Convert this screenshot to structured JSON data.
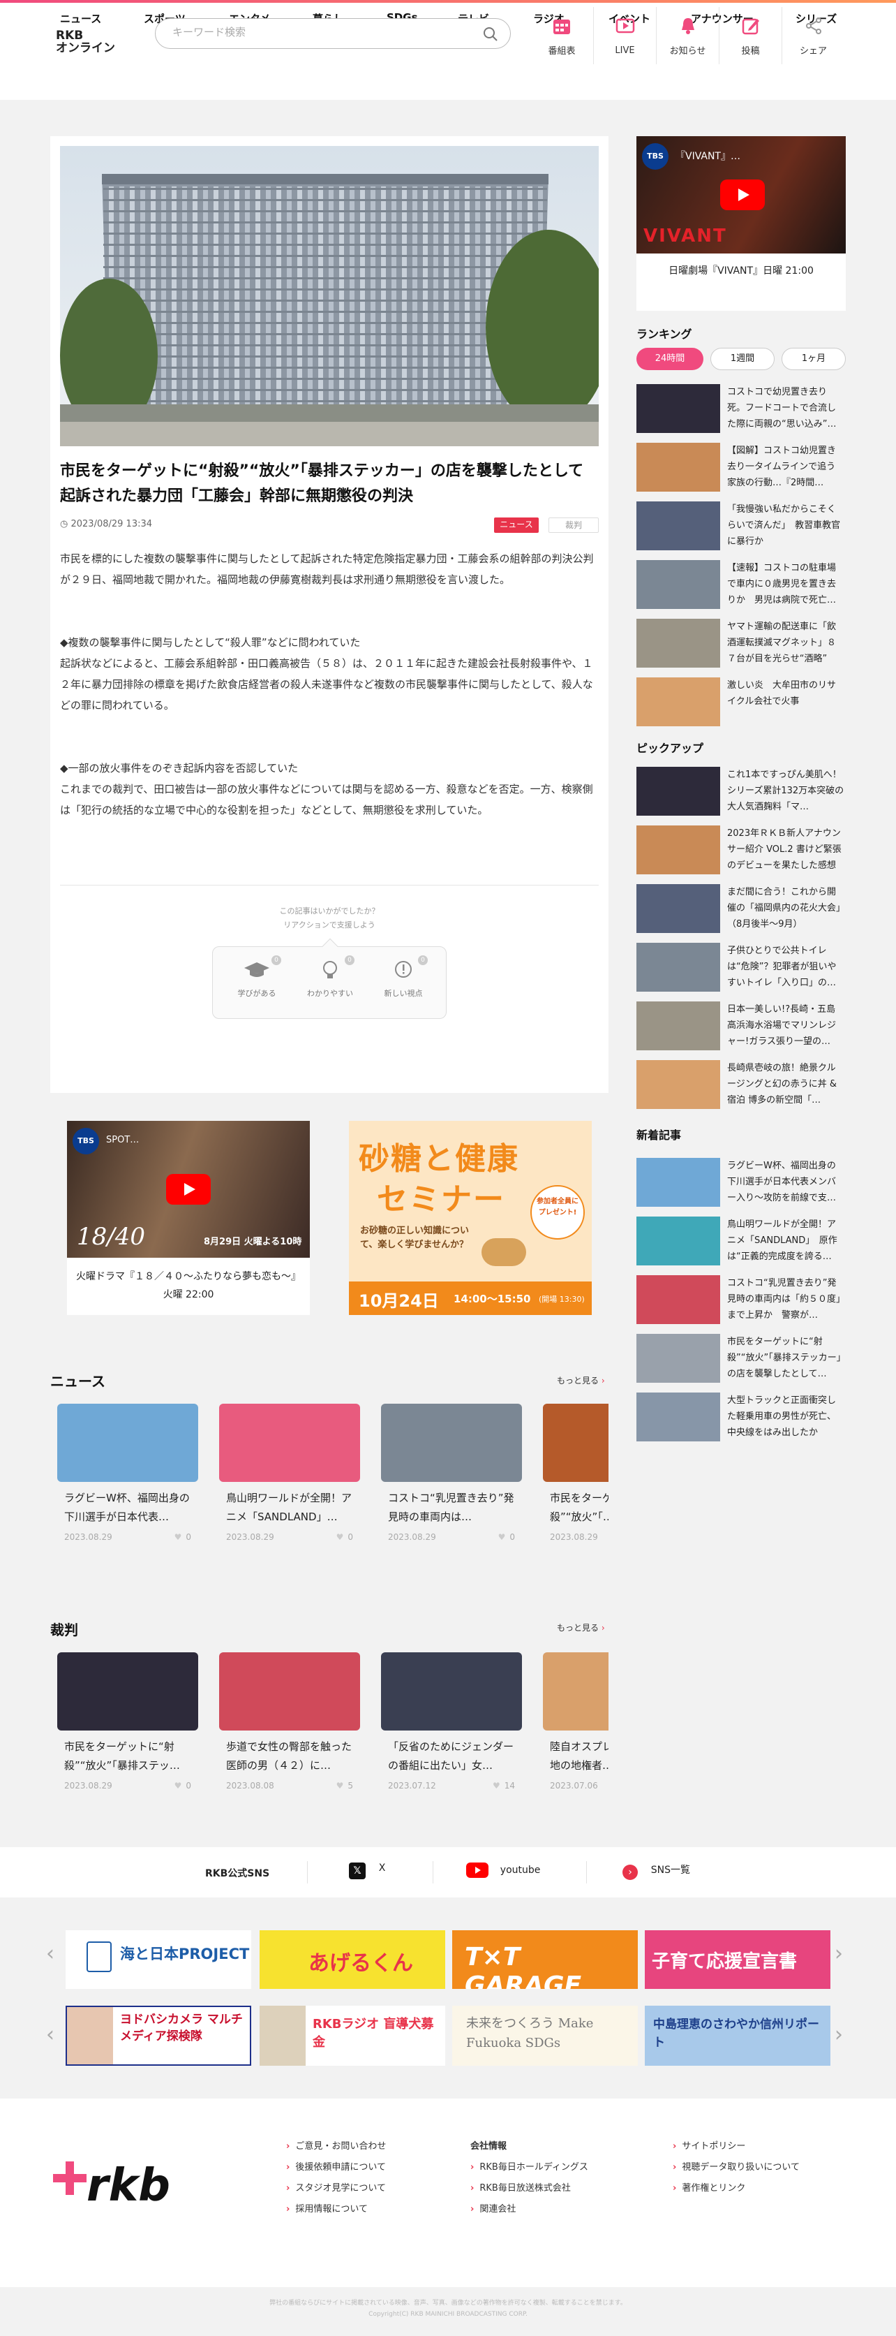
{
  "header": {
    "nav": [
      "ニュース",
      "スポーツ",
      "エンタメ",
      "暮らし",
      "SDGs",
      "テレビ",
      "ラジオ",
      "イベント",
      "アナウンサー",
      "シリーズ"
    ],
    "logo": [
      "RKB",
      "オンライン"
    ],
    "search_placeholder": "キーワード検索",
    "buttons": [
      "番組表",
      "LIVE",
      "お知らせ",
      "投稿",
      "シェア"
    ]
  },
  "article": {
    "title": "市民をターゲットに“射殺”“放火”「暴排ステッカー」の店を襲撃したとして起訴された暴力団「工藤会」幹部に無期懲役の判決",
    "date": "2023/08/29 13:34",
    "tag_news": "ニュース",
    "tag_court": "裁判",
    "body": [
      "市民を標的にした複数の襲撃事件に関与したとして起訴された特定危険指定暴力団・工藤会系の組幹部の判決公判が２９日、福岡地裁で開かれた。福岡地裁の伊藤寛樹裁判長は求刑通り無期懲役を言い渡した。",
      "◆複数の襲撃事件に関与したとして“殺人罪”などに問われていた",
      "起訴状などによると、工藤会系組幹部・田口義高被告（５８）は、２０１１年に起きた建設会社長射殺事件や、１２年に暴力団排除の標章を掲げた飲食店経営者の殺人未遂事件など複数の市民襲撃事件に関与したとして、殺人などの罪に問われている。",
      "◆一部の放火事件をのぞき起訴内容を否認していた",
      "これまでの裁判で、田口被告は一部の放火事件などについては関与を認める一方、殺意などを否定。一方、検察側は「犯行の統括的な立場で中心的な役割を担った」などとして、無期懲役を求刑していた。"
    ],
    "reaction_q1": "この記事はいかがでしたか？",
    "reaction_q2": "リアクションで支援しよう",
    "reactions": [
      {
        "label": "学びがある",
        "count": "0"
      },
      {
        "label": "わかりやすい",
        "count": "0"
      },
      {
        "label": "新しい視点",
        "count": "0"
      }
    ]
  },
  "sidebar": {
    "video_title": "『VIVANT』…",
    "video_caption": "日曜劇場『VIVANT』日曜 21:00",
    "ranking_title": "ランキング",
    "ranking_tabs": [
      "24時間",
      "1週間",
      "1ヶ月"
    ],
    "ranking": [
      "コストコで幼児置き去り死。フードコートで合流した際に両親の“思い込み”…",
      "【図解】コストコ幼児置き去り一タイムラインで追う家族の行動…『2時間…",
      "「我慢強い私だからこそくらいで済んだ」　教習車教官に暴行か",
      "【速報】コストコの駐車場で車内に０歳男児を置き去りか　男児は病院で死亡…",
      "ヤマト運輸の配送車に「飲酒運転撲滅マグネット」８７台が目を光らせ“酒略”",
      "激しい炎　大牟田市のリサイクル会社で火事"
    ],
    "pickup_title": "ピックアップ",
    "pickup": [
      "これ1本ですっぴん美肌へ！シリーズ累計132万本突破の大人気酒麹料「マ…",
      "2023年ＲＫＢ新人アナウンサー紹介 VOL.2 書けど緊張のデビューを果たした感想",
      "まだ間に合う！これから開催の「福岡県内の花火大会」（8月後半〜9月）",
      "子供ひとりで公共トイレは“危険”？犯罪者が狙いやすいトイレ「入り口」の…",
      "日本一美しい!?長崎・五島高浜海水浴場でマリンレジャー!ガラス張り一望の…",
      "長崎県壱岐の旅！絶景クルージングと幻の赤うに丼 & 宿泊 博多の新空間「…"
    ],
    "new_title": "新着記事",
    "new": [
      "ラグビーW杯、福岡出身の下川選手が日本代表メンバー入り〜攻防を前線で支…",
      "鳥山明ワールドが全開！アニメ「SANDLAND」　原作は“正義的完成度を誇る…",
      "コストコ“乳児置き去り”発見時の車両内は「約５０度」まで上昇か　警察が…",
      "市民をターゲットに“射殺”“放火”「暴排ステッカー」の店を襲撃したとして…",
      "大型トラックと正面衝突した軽乗用車の男性が死亡、中央線をはみ出したか"
    ]
  },
  "promos": {
    "left_caption": "火曜ドラマ『１８／４０〜ふたりなら夢も恋も〜』火曜 22:00",
    "left_video_title": "SPOT…",
    "left_overlay": "18/40",
    "left_air": "8月29日 火曜よる10時",
    "right_title": "砂糖と健康",
    "right_title2": "セミナー",
    "right_sub": "お砂糖の正しい知識について、楽しく学びませんか？",
    "right_badge": "参加者全員にプレゼント!",
    "right_date": "10月24日",
    "right_time": "14:00〜15:50",
    "right_open": "(開場 13:30)"
  },
  "news": {
    "title": "ニュース",
    "more": "もっと見る",
    "items": [
      {
        "title": "ラグビーW杯、福岡出身の下川選手が日本代表…",
        "date": "2023.08.29",
        "likes": "0"
      },
      {
        "title": "鳥山明ワールドが全開！アニメ「SANDLAND」…",
        "date": "2023.08.29",
        "likes": "0"
      },
      {
        "title": "コストコ“乳児置き去り”発見時の車両内は…",
        "date": "2023.08.29",
        "likes": "0"
      },
      {
        "title": "市民をターゲットに“射殺”“放火”「…",
        "date": "2023.08.29",
        "likes": ""
      }
    ]
  },
  "court": {
    "title": "裁判",
    "more": "もっと見る",
    "items": [
      {
        "title": "市民をターゲットに“射殺”“放火”「暴排ステッ…",
        "date": "2023.08.29",
        "likes": "0"
      },
      {
        "title": "歩道で女性の臀部を触った医師の男（４２）に…",
        "date": "2023.08.08",
        "likes": "5"
      },
      {
        "title": "「反省のためにジェンダーの番組に出たい」女…",
        "date": "2023.07.12",
        "likes": "14"
      },
      {
        "title": "陸自オスプレイ 佐賀駐屯地の地権者…",
        "date": "2023.07.06",
        "likes": ""
      }
    ]
  },
  "sns": {
    "label": "RKB公式SNS",
    "x": "X",
    "youtube": "youtube",
    "list": "SNS一覧"
  },
  "banners": {
    "row1": [
      "海と日本PROJECT",
      "あげるくん",
      "T×T GARAGE",
      "子育て応援宣言書"
    ],
    "row2": [
      "ヨドバシカメラ マルチメディア探検隊",
      "RKBラジオ 盲導犬募金",
      "未来をつくろう Make Fukuoka SDGs",
      "中島理恵のさわやか信州リポート"
    ]
  },
  "footer": {
    "col1": [
      "ご意見・お問い合わせ",
      "後援依頼申請について",
      "スタジオ見学について",
      "採用情報について"
    ],
    "col2_title": "会社情報",
    "col2": [
      "RKB毎日ホールディングス",
      "RKB毎日放送株式会社",
      "関連会社"
    ],
    "col3": [
      "サイトポリシー",
      "視聴データ取り扱いについて",
      "著作権とリンク"
    ],
    "notice": "弊社の番組ならびにサイトに掲載されている映像、音声、写真、画像などの著作物を許可なく複製、転載することを禁じます。",
    "copyright": "Copyright(C) RKB MAINICHI BROADCASTING CORP."
  },
  "colors": {
    "accent": "#e8334a",
    "pink": "#f04a7e"
  }
}
